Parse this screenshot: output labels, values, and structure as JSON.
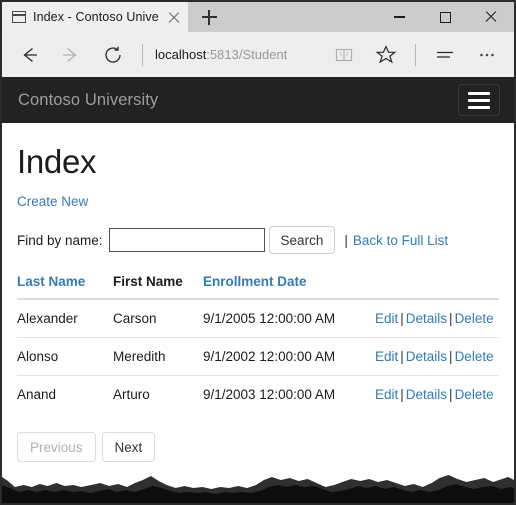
{
  "browser": {
    "tab": {
      "title": "Index - Contoso Univers",
      "favicon_icon": "page-icon",
      "close_icon": "close-icon"
    },
    "new_tab_icon": "plus-icon",
    "window_controls": {
      "minimize_icon": "minimize-icon",
      "maximize_icon": "maximize-icon",
      "close_icon": "close-icon"
    },
    "toolbar": {
      "back_icon": "back-arrow-icon",
      "forward_icon": "forward-arrow-icon",
      "refresh_icon": "refresh-icon",
      "url_host": "localhost",
      "url_rest": ":5813/Student",
      "reading_view_icon": "book-icon",
      "favorites_icon": "star-icon",
      "hub_icon": "hub-lines-icon",
      "more_icon": "ellipsis-icon"
    }
  },
  "navbar": {
    "brand": "Contoso University",
    "toggle_icon": "hamburger-icon"
  },
  "main": {
    "title": "Index",
    "create_new_label": "Create New",
    "search": {
      "label": "Find by name:",
      "value": "",
      "placeholder": "",
      "button_label": "Search",
      "separator": "|",
      "back_to_full_list_label": "Back to Full List"
    },
    "table": {
      "headers": [
        {
          "label": "Last Name",
          "sortable": true
        },
        {
          "label": "First Name",
          "sortable": false
        },
        {
          "label": "Enrollment Date",
          "sortable": true
        },
        {
          "label": "",
          "sortable": false
        }
      ],
      "rows": [
        {
          "last_name": "Alexander",
          "first_name": "Carson",
          "enrollment_date": "9/1/2005 12:00:00 AM",
          "actions": [
            "Edit",
            "Details",
            "Delete"
          ]
        },
        {
          "last_name": "Alonso",
          "first_name": "Meredith",
          "enrollment_date": "9/1/2002 12:00:00 AM",
          "actions": [
            "Edit",
            "Details",
            "Delete"
          ]
        },
        {
          "last_name": "Anand",
          "first_name": "Arturo",
          "enrollment_date": "9/1/2003 12:00:00 AM",
          "actions": [
            "Edit",
            "Details",
            "Delete"
          ]
        }
      ],
      "action_separator": "|"
    },
    "pager": {
      "previous_label": "Previous",
      "previous_disabled": true,
      "next_label": "Next",
      "next_disabled": false
    }
  },
  "colors": {
    "link": "#337ab7",
    "navbar_bg": "#222222",
    "brand_text": "#9d9d9d",
    "titlebar_bg": "#cccccc",
    "toolbar_bg": "#eeeeee"
  }
}
